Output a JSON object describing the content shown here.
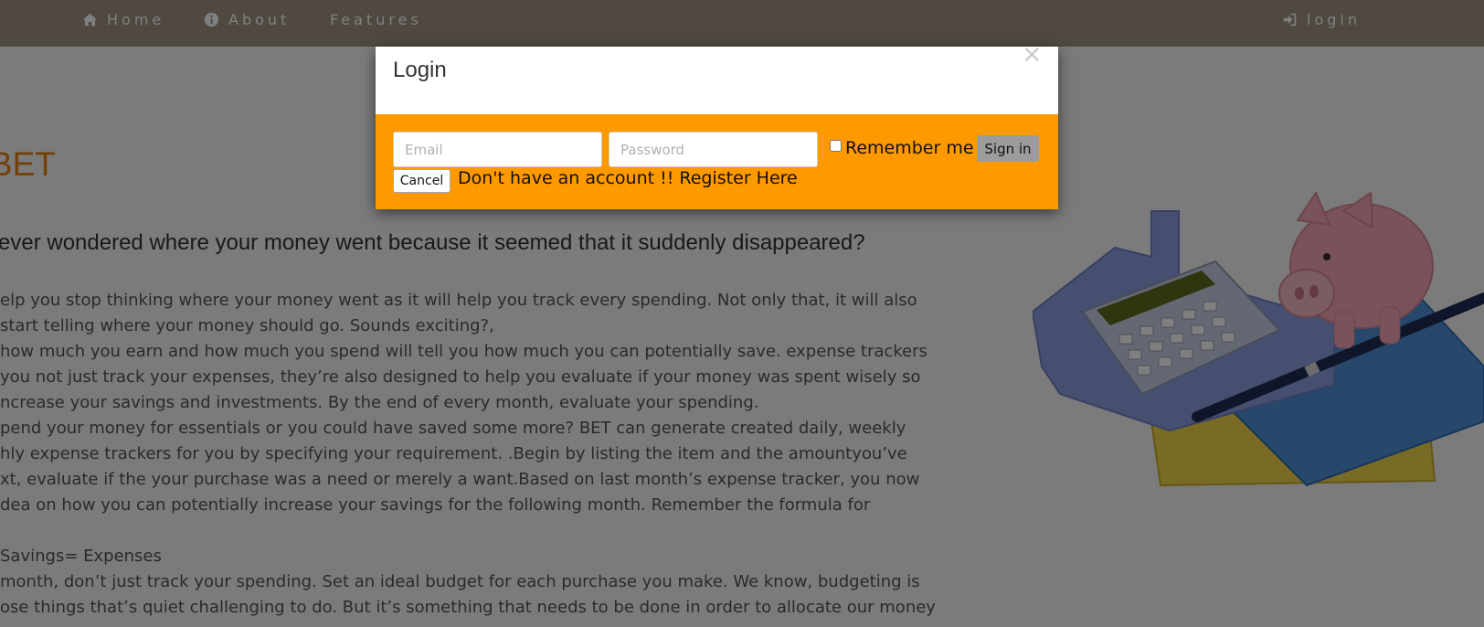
{
  "nav": {
    "home_label": "Home",
    "about_label": "About",
    "features_label": "Features",
    "login_label": "login",
    "home_icon": "home-icon",
    "about_icon": "info-icon",
    "login_icon": "sign-in-icon"
  },
  "page": {
    "heading": "UT BET",
    "question": "u ever wondered where your money went because it seemed that it suddenly disappeared?",
    "paragraph_lines": [
      "elp you stop thinking where your money went as it will help you track every spending. Not only that, it will also",
      "start telling where your money should go. Sounds exciting?,",
      "how much you earn and how much you spend will tell you how much you can potentially save. expense trackers",
      " you not just track your expenses, they’re also designed to help you evaluate if your money was spent wisely so",
      "ncrease your savings and investments. By the end of every month, evaluate your spending.",
      "pend your money for essentials or you could have saved some more? BET can generate created daily, weekly",
      "hly expense trackers for you by specifying your requirement. .Begin by listing the item and the amountyou’ve",
      "xt, evaluate if the your purchase was a need or merely a want.Based on last month’s expense tracker, you now",
      "dea on how you can potentially increase your savings for the following month. Remember the formula for",
      "",
      "Savings= Expenses",
      "month, don’t just track your spending. Set an ideal budget for each purchase you make. We know, budgeting is",
      "ose things that’s quiet challenging to do. But it’s something that needs to be done in order to allocate our money"
    ]
  },
  "modal": {
    "title": "Login",
    "close_symbol": "×",
    "email_placeholder": "Email",
    "password_placeholder": "Password",
    "remember_label": "Remember me",
    "signin_label": "Sign in",
    "cancel_label": "Cancel",
    "register_text": "Don't have an account !! Register Here"
  },
  "colors": {
    "navbar": "#a09383",
    "heading": "#e3820d",
    "modal_body": "#ff9900",
    "overlay": "rgba(0,0,0,0.5)"
  }
}
